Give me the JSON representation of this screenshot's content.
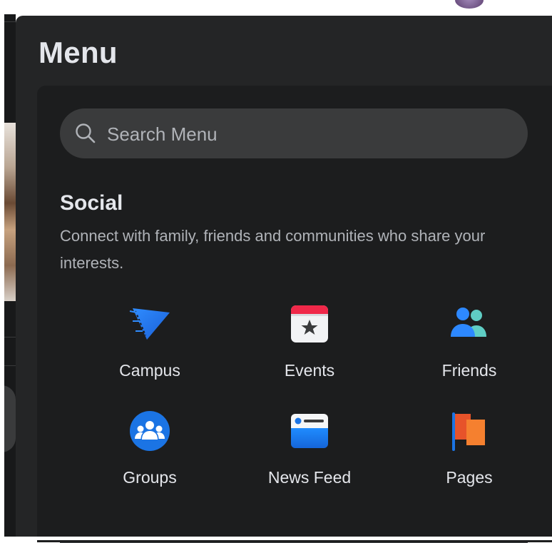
{
  "menu": {
    "title": "Menu",
    "search": {
      "placeholder": "Search Menu"
    },
    "section": {
      "title": "Social",
      "description": "Connect with family, friends and communities who share your interests."
    },
    "shortcuts": [
      {
        "label": "Campus",
        "icon": "campus-pennant-icon"
      },
      {
        "label": "Events",
        "icon": "calendar-star-icon"
      },
      {
        "label": "Friends",
        "icon": "friends-people-icon"
      },
      {
        "label": "Groups",
        "icon": "groups-circle-icon"
      },
      {
        "label": "News Feed",
        "icon": "news-feed-card-icon"
      },
      {
        "label": "Pages",
        "icon": "pages-flag-icon"
      }
    ]
  },
  "colors": {
    "panel_bg": "#242526",
    "card_bg": "#1c1d1e",
    "search_bg": "#3a3b3c",
    "text_primary": "#e4e6eb",
    "text_secondary": "#b0b3b8",
    "accent_blue": "#1877f2"
  }
}
